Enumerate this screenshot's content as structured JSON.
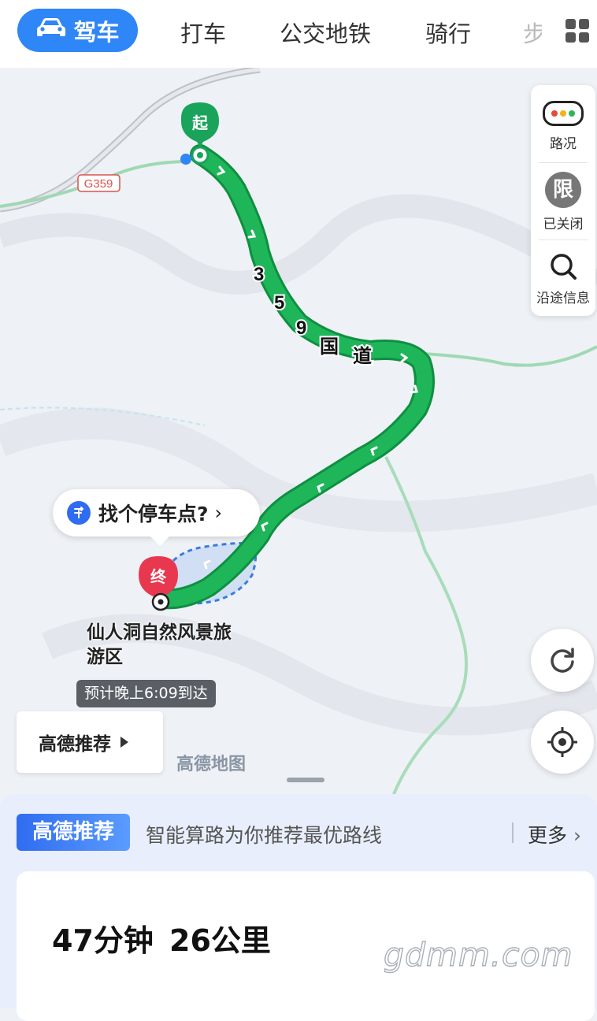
{
  "tabs": {
    "drive": "驾车",
    "taxi": "打车",
    "transit": "公交地铁",
    "bike": "骑行",
    "walk_partial": "步"
  },
  "map": {
    "road_badge": "G359",
    "start_marker": "起",
    "end_marker": "终",
    "route_label": [
      "3",
      "5",
      "9",
      "国",
      "道"
    ],
    "parking_prompt": "找个停车点?",
    "destination_name": "仙人洞自然风景旅游区",
    "eta": "预计晚上6:09到达",
    "recommend_button": "高德推荐",
    "map_watermark": "高德地图",
    "route_color": "#1fb65a"
  },
  "side_panel": {
    "traffic": "路况",
    "restriction_badge": "限",
    "restriction": "已关闭",
    "along_route": "沿途信息"
  },
  "bottom": {
    "tag": "高德推荐",
    "tagline": "智能算路为你推荐最优路线",
    "more": "更多",
    "duration": "47分钟",
    "distance": "26公里",
    "watermark": "gdmm.com"
  }
}
